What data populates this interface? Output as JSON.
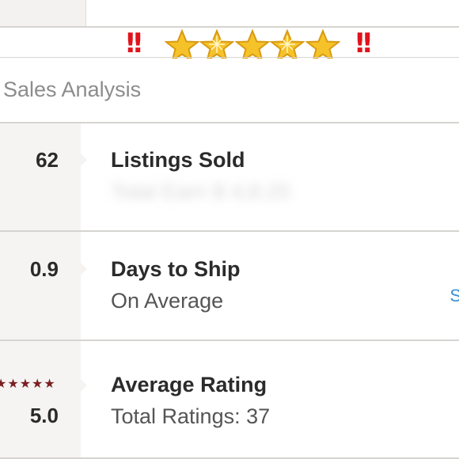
{
  "emoji_banner": {
    "left_marks": "!!",
    "right_marks": "!!",
    "stars": [
      "star",
      "sparkle-star",
      "star",
      "sparkle-star",
      "star"
    ]
  },
  "section": {
    "title": "Sales Analysis"
  },
  "stats": [
    {
      "value": "62",
      "label": "Listings Sold",
      "sub": "Total Earn        $ 4,8.20"
    },
    {
      "value": "0.9",
      "label": "Days to Ship",
      "sub": "On Average"
    },
    {
      "value": "5.0",
      "label": "Average Rating",
      "sub": "Total Ratings: 37",
      "stars": "★★★★★"
    }
  ],
  "link_hint": "S",
  "colors": {
    "accent_red": "#e0141b",
    "star_yellow": "#f6c22a",
    "rating_star": "#7a1f24",
    "link_blue": "#3a8fd8"
  }
}
